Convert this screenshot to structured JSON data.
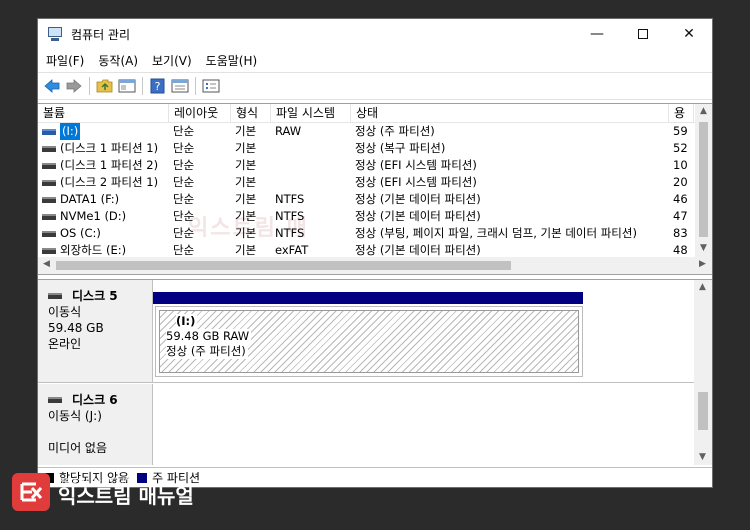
{
  "window": {
    "title": "컴퓨터 관리",
    "minimize": "—",
    "close": "✕"
  },
  "menu": [
    "파일(F)",
    "동작(A)",
    "보기(V)",
    "도움말(H)"
  ],
  "table": {
    "headers": [
      "볼륨",
      "레이아웃",
      "형식",
      "파일 시스템",
      "상태",
      "용"
    ],
    "rows": [
      {
        "vol": "(I:)",
        "layout": "단순",
        "type": "기본",
        "fs": "RAW",
        "status": "정상 (주 파티션)",
        "cap": "59"
      },
      {
        "vol": "(디스크 1 파티션 1)",
        "layout": "단순",
        "type": "기본",
        "fs": "",
        "status": "정상 (복구 파티션)",
        "cap": "52"
      },
      {
        "vol": "(디스크 1 파티션 2)",
        "layout": "단순",
        "type": "기본",
        "fs": "",
        "status": "정상 (EFI 시스템 파티션)",
        "cap": "10"
      },
      {
        "vol": "(디스크 2 파티션 1)",
        "layout": "단순",
        "type": "기본",
        "fs": "",
        "status": "정상 (EFI 시스템 파티션)",
        "cap": "20"
      },
      {
        "vol": "DATA1 (F:)",
        "layout": "단순",
        "type": "기본",
        "fs": "NTFS",
        "status": "정상 (기본 데이터 파티션)",
        "cap": "46"
      },
      {
        "vol": "NVMe1 (D:)",
        "layout": "단순",
        "type": "기본",
        "fs": "NTFS",
        "status": "정상 (기본 데이터 파티션)",
        "cap": "47"
      },
      {
        "vol": "OS (C:)",
        "layout": "단순",
        "type": "기본",
        "fs": "NTFS",
        "status": "정상 (부팅, 페이지 파일, 크래시 덤프, 기본 데이터 파티션)",
        "cap": "83"
      },
      {
        "vol": "외장하드 (E:)",
        "layout": "단순",
        "type": "기본",
        "fs": "exFAT",
        "status": "정상 (기본 데이터 파티션)",
        "cap": "48"
      }
    ]
  },
  "disks": {
    "disk5": {
      "name": "디스크 5",
      "type": "이동식",
      "size": "59.48 GB",
      "state": "온라인",
      "partition": {
        "label": "(I:)",
        "size": "59.48 GB RAW",
        "status": "정상 (주 파티션)"
      }
    },
    "disk6": {
      "name": "디스크 6",
      "type": "이동식 (J:)",
      "state": "미디어 없음"
    }
  },
  "legend": {
    "unallocated": "할당되지 않음",
    "primary": "주 파티션"
  },
  "watermark": {
    "center": "익스트림 매",
    "tagline": "More Better IT Life",
    "brand": "익스트림 매뉴얼"
  },
  "colors": {
    "partition_bar": "#000080",
    "selection": "#0078d7",
    "watermark_red": "#e13c3c"
  }
}
